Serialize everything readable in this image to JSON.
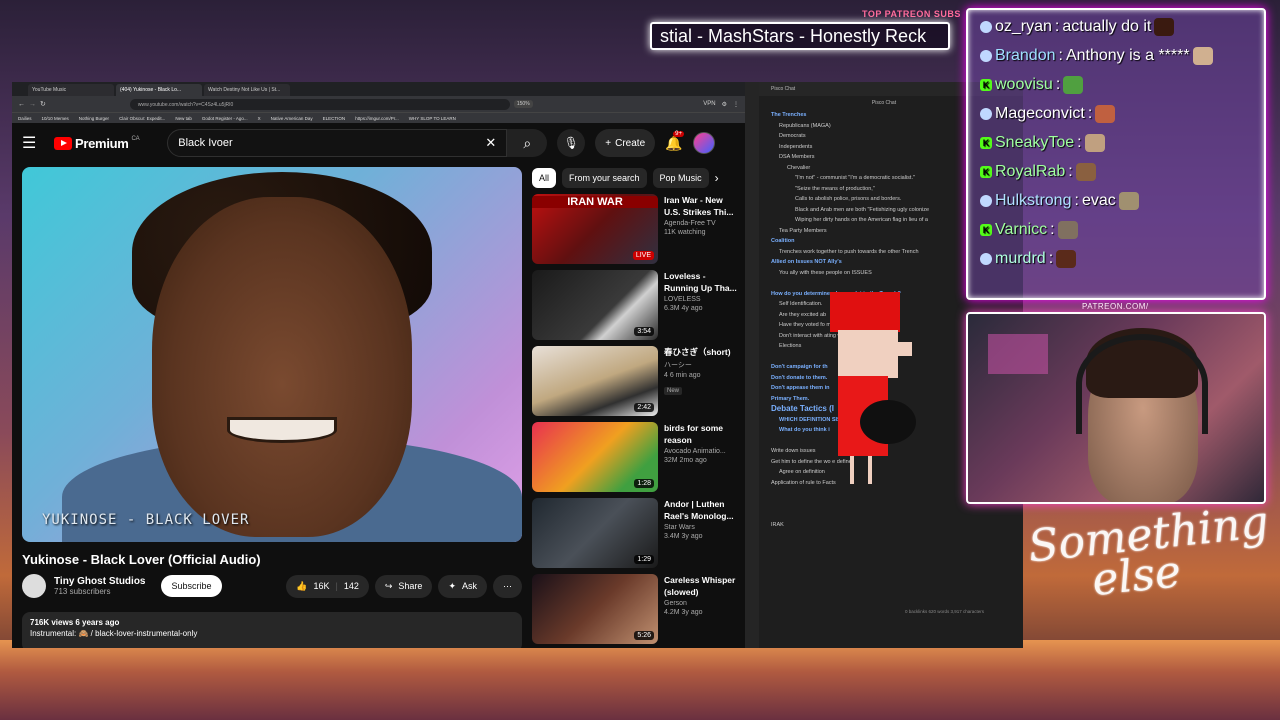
{
  "overlay": {
    "top_patreon_label": "TOP PATREON SUBS",
    "marquee_text": "stial - MashStars - Honestly Reck",
    "cam_label": "PATREON.COM/",
    "brand_line1": "Something",
    "brand_line2": "else"
  },
  "browser": {
    "tabs": [
      {
        "label": "YouTube Music"
      },
      {
        "label": "(404) Yukinose - Black Lo..."
      },
      {
        "label": "Watch Destiny Not Like Us | St..."
      }
    ],
    "url": "www.youtube.com/watch?v=C4Sz4Lu5jRI0",
    "zoom": "150%",
    "vpn": "VPN",
    "bookmarks": [
      "Dailies",
      "10/10 Memes",
      "Nothing Burger",
      "Clair Obscur: Expedit...",
      "New tab",
      "Godot Register - Ago...",
      "X",
      "Native American Day",
      "ELECTION",
      "https://imgur.com/Pr...",
      "WHY SLOP TO LEARN"
    ]
  },
  "youtube": {
    "logo_text": "Premium",
    "logo_region": "CA",
    "search_value": "Black Ivoer",
    "create_label": "Create",
    "notif_count": "9+",
    "video_overlay": "YUKINOSE - BLACK LOVER",
    "video_title": "Yukinose - Black Lover (Official Audio)",
    "channel_name": "Tiny Ghost Studios",
    "channel_subs": "713 subscribers",
    "subscribe_label": "Subscribe",
    "likes": "16K",
    "comments": "142",
    "share_label": "Share",
    "ask_label": "Ask",
    "desc_stats": "716K views  6 years ago",
    "desc_text": "Instrumental: 🙈 / black-lover-instrumental-only",
    "chips": [
      "All",
      "From your search",
      "Pop Music"
    ],
    "recommendations": [
      {
        "title": "Iran War - New U.S. Strikes Thi...",
        "channel": "Agenda-Free TV",
        "meta": "11K watching",
        "badge": "LIVE",
        "thumb_label": "IRAN WAR"
      },
      {
        "title": "Loveless - Running Up Tha...",
        "channel": "LOVELESS",
        "meta": "6.3M  4y ago",
        "badge": "3:54"
      },
      {
        "title": "春ひさぎ（short)",
        "channel": "ハーシー",
        "meta": "4  6 min ago",
        "badge": "2:42",
        "new": "New"
      },
      {
        "title": "birds for some reason",
        "channel": "Avocado Animatio...",
        "meta": "32M  2mo ago",
        "badge": "1:28"
      },
      {
        "title": "Andor | Luthen Rael's Monolog...",
        "channel": "Star Wars",
        "meta": "3.4M  3y ago",
        "badge": "1:29"
      },
      {
        "title": "Careless Whisper (slowed)",
        "channel": "Gerson",
        "meta": "4.2M  3y ago",
        "badge": "5:26"
      }
    ]
  },
  "notes": {
    "tab": "Pisco Chat",
    "title": "Pisco Chat",
    "lines": [
      {
        "t": "The Trenches",
        "c": "nh",
        "i": 0
      },
      {
        "t": "Republicans (MAGA)",
        "i": 1
      },
      {
        "t": "Democrats",
        "i": 1
      },
      {
        "t": "Independents",
        "i": 1
      },
      {
        "t": "DSA Members",
        "i": 1
      },
      {
        "t": "Chevalier",
        "i": 2
      },
      {
        "t": "\"I'm not\" - communist \"I'm a democratic socialist.\"",
        "i": 3
      },
      {
        "t": "\"Seize the means of production,\"",
        "i": 3
      },
      {
        "t": "Calls to abolish police, prisons and borders.",
        "i": 3
      },
      {
        "t": "Black and Arab men are both \"Fetishizing ugly colonize",
        "i": 3
      },
      {
        "t": "Wiping her dirty hands on the American flag in lieu of a",
        "i": 3
      },
      {
        "t": "Tea Party Members",
        "i": 1
      },
      {
        "t": "Coalition",
        "c": "nh",
        "i": 0
      },
      {
        "t": "Trenches work together to push towards the other Trench",
        "i": 1
      },
      {
        "t": "Allied on Issues NOT Ally's",
        "c": "nh",
        "i": 0
      },
      {
        "t": "You ally with these people on ISSUES",
        "i": 1
      },
      {
        "t": "",
        "i": 0
      },
      {
        "t": "How do you determine who you let in the Trench?",
        "c": "nh",
        "i": 0
      },
      {
        "t": "Self Identification.",
        "i": 1
      },
      {
        "t": "Are they excited ab",
        "i": 1
      },
      {
        "t": "Have they voted fo                        matters?",
        "i": 1
      },
      {
        "t": "Don't interact with                         ating way during a",
        "i": 1
      },
      {
        "t": "Elections",
        "i": 1
      },
      {
        "t": "",
        "i": 0
      },
      {
        "t": "Don't campaign for th",
        "c": "nh",
        "i": 0
      },
      {
        "t": "Don't donate to them.",
        "c": "nh",
        "i": 0
      },
      {
        "t": "Don't appease them in",
        "c": "nh",
        "i": 0
      },
      {
        "t": "Primary Them.",
        "c": "nh",
        "i": 0
      },
      {
        "t": "Debate Tactics (I",
        "c": "nh big",
        "i": 0
      },
      {
        "t": "WHICH DEFINITION                 SISTENTLY USING",
        "c": "nh",
        "i": 1
      },
      {
        "t": "What do you think i",
        "c": "nh",
        "i": 1
      },
      {
        "t": "",
        "i": 0
      },
      {
        "t": "Write down issues",
        "i": 0
      },
      {
        "t": "Get him to define the wo                            e define",
        "i": 0
      },
      {
        "t": "Agree on definition",
        "i": 1
      },
      {
        "t": "Application of rule to Facts",
        "i": 0
      },
      {
        "t": "",
        "i": 0
      },
      {
        "t": "",
        "i": 0
      },
      {
        "t": "",
        "i": 0
      },
      {
        "t": "IRAK",
        "i": 0
      }
    ],
    "status": "0 backlinks   620 words  3,917 characters"
  },
  "chat": [
    {
      "user": "oz_ryan",
      "msg": "actually do it",
      "badge": "dot",
      "emote": "#3a1a10"
    },
    {
      "user": "Brandon",
      "msg": "Anthony is a *****",
      "badge": "dot",
      "userColor": "#a0e0ff",
      "emote": "#d0b090"
    },
    {
      "user": "woovisu",
      "msg": "",
      "badge": "k",
      "userColor": "#a0ffa0",
      "emote": "#50a040"
    },
    {
      "user": "Mageconvict",
      "msg": "",
      "badge": "dot",
      "emote": "#c06040"
    },
    {
      "user": "SneakyToe",
      "msg": "",
      "badge": "k",
      "userColor": "#a0ffa0",
      "emote": "#c0a080"
    },
    {
      "user": "RoyalRab",
      "msg": "",
      "badge": "k",
      "userColor": "#a0ffa0",
      "emote": "#8a6040"
    },
    {
      "user": "Hulkstrong",
      "msg": "evac",
      "badge": "dot",
      "userColor": "#b0e0ff",
      "emote": "#a09070"
    },
    {
      "user": "Varnicc",
      "msg": "",
      "badge": "k",
      "userColor": "#a0ffa0",
      "emote": "#807060"
    },
    {
      "user": "murdrd",
      "msg": "",
      "badge": "dot",
      "userColor": "#b0ffe0",
      "emote": "#5a2a1a"
    }
  ]
}
